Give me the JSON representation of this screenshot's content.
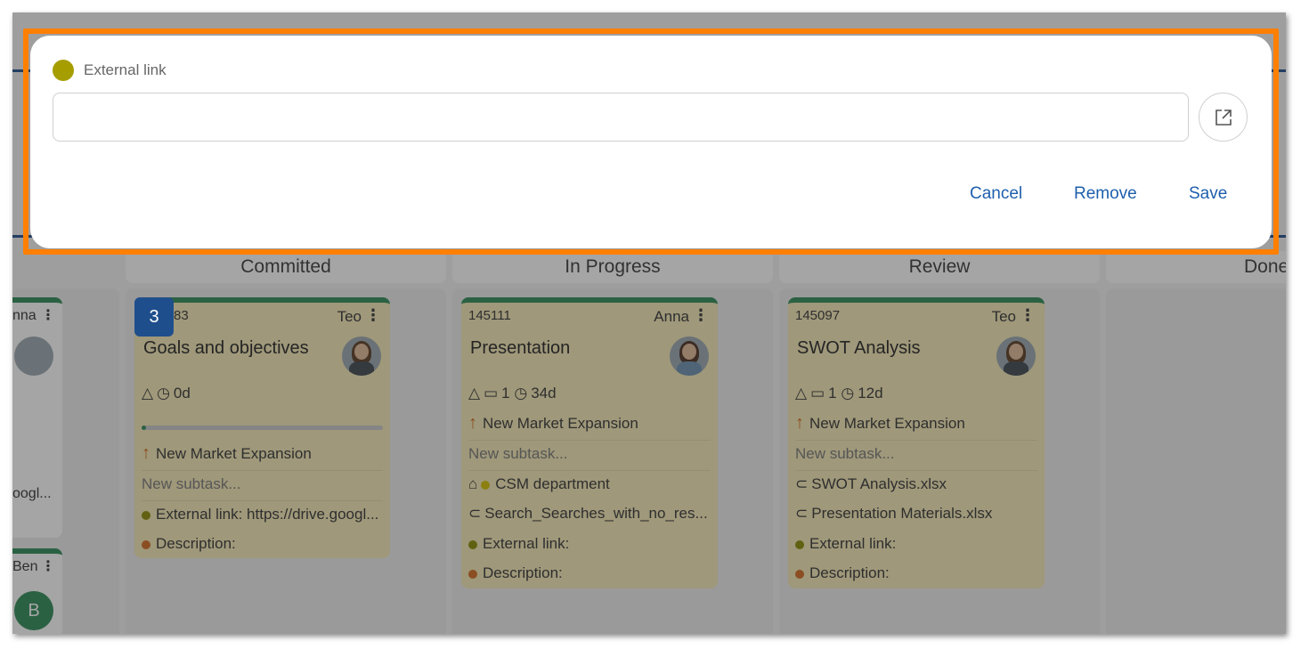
{
  "modal": {
    "label": "External link",
    "input_value": "",
    "buttons": {
      "cancel": "Cancel",
      "remove": "Remove",
      "save": "Save"
    },
    "label_dot_color": "#a69e00",
    "highlight_color": "#ff7f00"
  },
  "columns": [
    {
      "title": "Committed"
    },
    {
      "title": "In Progress"
    },
    {
      "title": "Review"
    },
    {
      "title": "Done"
    }
  ],
  "left_partial": {
    "card1": {
      "owner": "nna",
      "link": "oogl..."
    },
    "card2": {
      "owner": "Ben",
      "avatar_initial": "B"
    }
  },
  "badge": "3",
  "cards": {
    "committed": {
      "id": "83",
      "owner": "Teo",
      "title": "Goals and objectives",
      "due": "0d",
      "progress": 0.02,
      "goal": "New Market Expansion",
      "subtask_placeholder": "New subtask...",
      "external_link": "External link: https://drive.googl...",
      "description": "Description:"
    },
    "in_progress": {
      "id": "145111",
      "owner": "Anna",
      "title": "Presentation",
      "comments": "1",
      "due": "34d",
      "goal": "New Market Expansion",
      "subtask_placeholder": "New subtask...",
      "tag": "CSM department",
      "attachment": "Search_Searches_with_no_res...",
      "external_link": "External link:",
      "description": "Description:"
    },
    "review": {
      "id": "145097",
      "owner": "Teo",
      "title": "SWOT Analysis",
      "comments": "1",
      "due": "12d",
      "goal": "New Market Expansion",
      "subtask_placeholder": "New subtask...",
      "attachment1": "SWOT Analysis.xlsx",
      "attachment2": "Presentation Materials.xlsx",
      "external_link": "External link:",
      "description": "Description:"
    }
  },
  "colors": {
    "card_bg": "#f4e9b5",
    "card_top": "#2e8b57",
    "link_dot": "#8a8a00",
    "desc_dot": "#d2691e",
    "tag_dot": "#d4c000",
    "button_text": "#1e5fad"
  }
}
